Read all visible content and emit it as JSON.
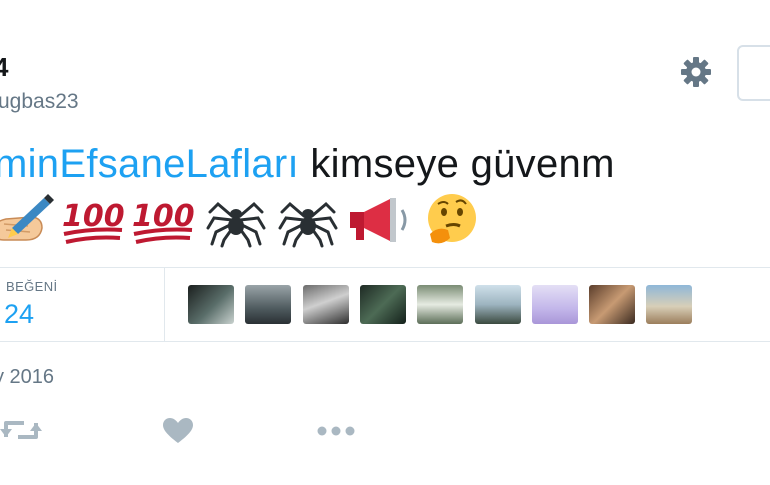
{
  "profile": {
    "display_name": "4",
    "handle": "ugbas23"
  },
  "icons": {
    "settings": "gear-icon",
    "retweet": "retweet-icon",
    "like": "heart-icon",
    "more": "more-dots-icon"
  },
  "tweet": {
    "hashtag": "minEfsaneLafları",
    "text": " kimseye güvenm",
    "emojis": [
      "writing-hand",
      "hundred-points",
      "hundred-points",
      "spider",
      "spider",
      "loudspeaker",
      "thinking-face"
    ],
    "date": "y 2016"
  },
  "stats": {
    "likes_label": "BEĞENİ",
    "likes_count": "24",
    "liker_avatars": 9
  },
  "colors": {
    "link": "#1da1f2",
    "text": "#14171a",
    "secondary": "#657786",
    "icon": "#aab8c2",
    "border": "#e1e8ed"
  }
}
